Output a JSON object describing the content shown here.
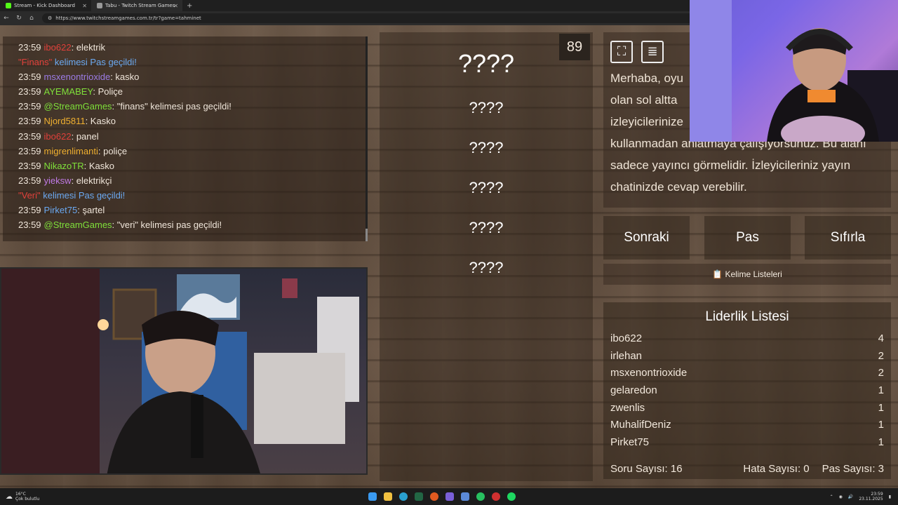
{
  "browser": {
    "tabs": [
      {
        "label": "Stream - Kick Dashboard",
        "active": false,
        "color": "#53fc18"
      },
      {
        "label": "Tabu - Twitch Stream Games",
        "active": true,
        "color": "#cccccc"
      }
    ],
    "url": "https://www.twitchstreamgames.com.tr/tr?game=tahminet"
  },
  "chat": {
    "messages": [
      {
        "time": "23:59",
        "user": "ibo622",
        "user_color": "#e0403a",
        "text": ": elektrik"
      },
      {
        "time": "",
        "user": "\"Finans\"",
        "user_color": "#e0403a",
        "text": " kelimesi Pas geçildi!",
        "system": true
      },
      {
        "time": "23:59",
        "user": "msxenontrioxide",
        "user_color": "#9c7ce6",
        "text": ": kasko"
      },
      {
        "time": "23:59",
        "user": "AYEMABEY",
        "user_color": "#7fe03a",
        "text": ": Poliçe"
      },
      {
        "time": "23:59",
        "user": "@StreamGames",
        "user_color": "#7fe03a",
        "text": ": \"finans\" kelimesi pas geçildi!"
      },
      {
        "time": "23:59",
        "user": "Njord5811",
        "user_color": "#f0b030",
        "text": ": Kasko"
      },
      {
        "time": "23:59",
        "user": "ibo622",
        "user_color": "#e0403a",
        "text": ": panel"
      },
      {
        "time": "23:59",
        "user": "migrenlimanti",
        "user_color": "#f0b030",
        "text": ": poliçe"
      },
      {
        "time": "23:59",
        "user": "NikazoTR",
        "user_color": "#7fe03a",
        "text": ": Kasko"
      },
      {
        "time": "23:59",
        "user": "yieksw",
        "user_color": "#c07ae6",
        "text": ": elektrikçi"
      },
      {
        "time": "",
        "user": "\"Veri\"",
        "user_color": "#e0403a",
        "text": " kelimesi Pas geçildi!",
        "system": true
      },
      {
        "time": "23:59",
        "user": "Pirket75",
        "user_color": "#6aa8f0",
        "text": ": şartel"
      },
      {
        "time": "23:59",
        "user": "@StreamGames",
        "user_color": "#7fe03a",
        "text": ": \"veri\" kelimesi pas geçildi!"
      }
    ]
  },
  "game": {
    "timer": "89",
    "main_word": "????",
    "forbidden_words": [
      "????",
      "????",
      "????",
      "????",
      "????"
    ]
  },
  "info": {
    "text": "Merhaba, oyu... olan sol altta ... izleyicilerinize ... kullanmadan anlatmaya çalışıyorsunuz. Bu alanı sadece yayıncı görmelidir. İzleyicileriniz yayın chatinizde cevap verebilir.",
    "lines": [
      "Merhaba, oyu",
      "olan sol altta",
      "izleyicilerinize",
      "kullanmadan anlatmaya çalışıyorsunuz. Bu alanı",
      "sadece yayıncı görmelidir. İzleyicileriniz yayın",
      "chatinizde cevap verebilir."
    ]
  },
  "buttons": {
    "next": "Sonraki",
    "pass": "Pas",
    "reset": "Sıfırla",
    "word_lists": "Kelime Listeleri"
  },
  "leaderboard": {
    "title": "Liderlik Listesi",
    "rows": [
      {
        "name": "ibo622",
        "score": "4"
      },
      {
        "name": "irlehan",
        "score": "2"
      },
      {
        "name": "msxenontrioxide",
        "score": "2"
      },
      {
        "name": "gelaredon",
        "score": "1"
      },
      {
        "name": "zwenlis",
        "score": "1"
      },
      {
        "name": "MuhalifDeniz",
        "score": "1"
      },
      {
        "name": "Pirket75",
        "score": "1"
      }
    ],
    "question_count": "Soru Sayısı: 16",
    "error_count": "Hata Sayısı: 0",
    "pass_count": "Pas Sayısı: 3"
  },
  "taskbar": {
    "weather_temp": "16°C",
    "weather_desc": "Çok bulutlu",
    "time": "23:59",
    "date": "23.11.2025"
  }
}
